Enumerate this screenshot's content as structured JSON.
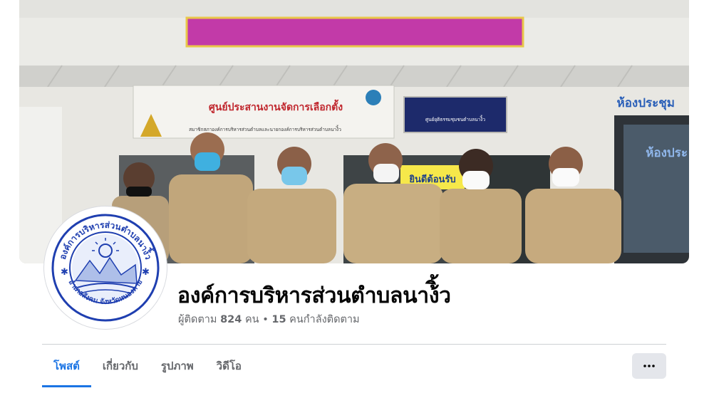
{
  "page": {
    "name": "องค์การบริหารส่วนตำบลนาง้ิ้ว",
    "followers_label": "ผู้ติดตาม",
    "followers_count": "824",
    "followers_unit": "คน",
    "separator": "•",
    "following_count": "15",
    "following_label": "คนกำลังติดตาม"
  },
  "cover": {
    "building_banner": "ศูนย์ประสานงานจัดการเลือกตั้ง",
    "building_banner_sub": "สมาชิกสภาองค์การบริหารส่วนตำบลและนายกองค์การบริหารส่วนตำบลนาง้ิ้ว",
    "side_sign": "ศูนย์ยุติธรรมชุมชนตำบลนาง้ิ้ว",
    "room_sign": "ห้องประชุม",
    "room_sign_2": "ห้องประ",
    "door_sign": "ยินดีต้อนรับ"
  },
  "avatar": {
    "seal_top": "องค์การบริหารส่วนตำบลนาง้ิ้ว",
    "seal_bottom": "อำเภอสังคม จังหวัดหนองคาย"
  },
  "tabs": [
    {
      "label": "โพสต์",
      "active": true
    },
    {
      "label": "เกี่ยวกับ",
      "active": false
    },
    {
      "label": "รูปภาพ",
      "active": false
    },
    {
      "label": "วิดีโอ",
      "active": false
    }
  ],
  "more_button": {
    "icon": "more-horizontal-icon"
  },
  "colors": {
    "accent": "#1b74e4",
    "secondary_text": "#65676b",
    "primary_text": "#050505",
    "button_bg": "#e4e6eb"
  }
}
